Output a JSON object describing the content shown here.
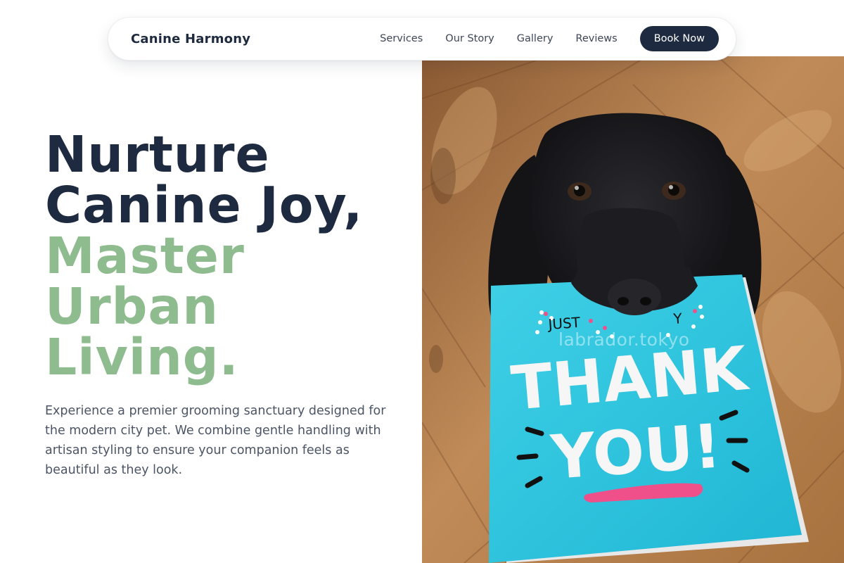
{
  "nav": {
    "brand": "Canine Harmony",
    "links": [
      "Services",
      "Our Story",
      "Gallery",
      "Reviews"
    ],
    "cta": "Book Now"
  },
  "hero": {
    "headline_lines_dark": [
      "Nurture",
      "Canine Joy,"
    ],
    "headline_lines_accent": [
      "Master",
      "Urban",
      "Living."
    ],
    "description": "Experience a premier grooming sanctuary designed for the modern city pet. We combine gentle handling with artisan styling to ensure your companion feels as beautiful as they look.",
    "image": {
      "card_small_text": "JUST",
      "card_small_text_right": "Y",
      "card_line1": "THANK",
      "card_line2": "YOU!",
      "watermark": "labrador.tokyo"
    }
  },
  "colors": {
    "dark": "#1e2a3f",
    "accent": "#8fbc8f",
    "body_text": "#4b5565",
    "card_blue": "#2ec4dc",
    "card_pink": "#f0508a"
  }
}
